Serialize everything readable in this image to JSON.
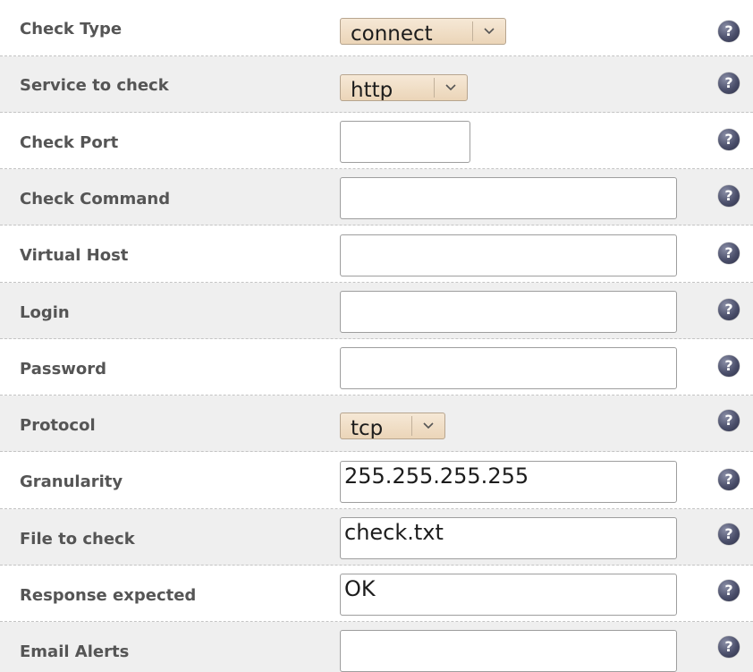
{
  "form": {
    "fields": [
      {
        "label": "Check Type",
        "control": "select",
        "value": "connect"
      },
      {
        "label": "Service to check",
        "control": "select",
        "value": "http"
      },
      {
        "label": "Check Port",
        "control": "input",
        "value": ""
      },
      {
        "label": "Check Command",
        "control": "input",
        "value": ""
      },
      {
        "label": "Virtual Host",
        "control": "input",
        "value": ""
      },
      {
        "label": "Login",
        "control": "input",
        "value": ""
      },
      {
        "label": "Password",
        "control": "input",
        "value": ""
      },
      {
        "label": "Protocol",
        "control": "select",
        "value": "tcp"
      },
      {
        "label": "Granularity",
        "control": "input",
        "value": "255.255.255.255"
      },
      {
        "label": "File to check",
        "control": "input",
        "value": "check.txt"
      },
      {
        "label": "Response expected",
        "control": "input",
        "value": "OK"
      },
      {
        "label": "Email Alerts",
        "control": "input",
        "value": ""
      }
    ],
    "help_glyph": "?",
    "dropdown_icon": "chevron-down-icon",
    "help_icon": "help-icon",
    "colors": {
      "row_alt_bg": "#efefef",
      "label_text": "#555555",
      "select_bg": "#f2e2cc",
      "help_icon": "#4b4f6b"
    }
  }
}
